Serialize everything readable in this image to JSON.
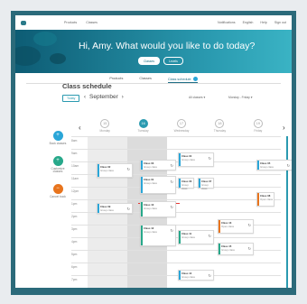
{
  "topnav": {
    "links": [
      "Products",
      "Classes",
      "Class schedule"
    ],
    "right_links": [
      "Notifications",
      "English",
      "Help",
      "Sign out"
    ]
  },
  "hero": {
    "greeting": "Hi, Amy. What would you like to do today?",
    "buttons": [
      "Classes",
      "Levels"
    ]
  },
  "subtabs": [
    "Products",
    "Classes",
    "Class schedule"
  ],
  "schedule": {
    "title": "Class schedule",
    "today_label": "Today",
    "month": "September",
    "filter_classes": "All classes",
    "filter_days": "Monday - Friday",
    "days": [
      {
        "num": "15",
        "name": "Monday"
      },
      {
        "num": "16",
        "name": "Tuesday"
      },
      {
        "num": "17",
        "name": "Wednesday"
      },
      {
        "num": "18",
        "name": "Thursday"
      },
      {
        "num": "19",
        "name": "Friday"
      }
    ],
    "times": [
      "8am",
      "9am",
      "10am",
      "11am",
      "12pm",
      "1pm",
      "2pm",
      "3pm",
      "4pm",
      "5pm",
      "6pm",
      "7pm"
    ]
  },
  "left_actions": [
    {
      "icon": "+",
      "label": "Book\nclasses",
      "color": "#2aa6d8"
    },
    {
      "icon": "+",
      "label": "Customize\nclasses",
      "color": "#27a88a"
    },
    {
      "icon": "−",
      "label": "Cancel\nbook",
      "color": "#e8741d"
    }
  ],
  "events": [
    {
      "name": "Class 02",
      "sub": "Group class",
      "color": "#2aa6d8"
    },
    {
      "name": "Class 03",
      "sub": "Group class",
      "color": "#2aa6d8"
    },
    {
      "name": "Class 04",
      "sub": "Group class",
      "color": "#2aa6d8"
    },
    {
      "name": "Class 05",
      "sub": "Group class",
      "color": "#2aa6d8"
    },
    {
      "name": "Class 01",
      "sub": "Group class",
      "color": "#2aa6d8"
    },
    {
      "name": "Class 06",
      "sub": "Group class",
      "color": "#2aa6d8"
    },
    {
      "name": "Class 07",
      "sub": "Group class",
      "color": "#2aa6d8"
    },
    {
      "name": "Class 08",
      "sub": "Open class",
      "color": "#e8741d"
    },
    {
      "name": "Class 09",
      "sub": "Group class",
      "color": "#2aa6d8"
    },
    {
      "name": "Class 10",
      "sub": "Group class",
      "color": "#27a88a"
    },
    {
      "name": "Class 11",
      "sub": "Group class",
      "color": "#27a88a"
    },
    {
      "name": "Class 12",
      "sub": "Group class",
      "color": "#27a88a"
    },
    {
      "name": "Class 13",
      "sub": "Open class",
      "color": "#e8741d"
    },
    {
      "name": "Class 14",
      "sub": "Group class",
      "color": "#2aa6d8"
    },
    {
      "name": "Class 15",
      "sub": "Group class",
      "color": "#27a88a"
    }
  ]
}
